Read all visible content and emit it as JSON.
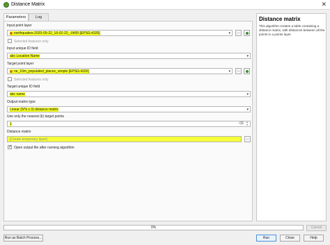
{
  "window": {
    "title": "Distance Matrix"
  },
  "tabs": [
    {
      "label": "Parameters"
    },
    {
      "label": "Log"
    }
  ],
  "form": {
    "input_point_layer": {
      "label": "Input point layer",
      "value": "earthquakes-2020-09-22_16-02-22_-0400 [EPSG:4326]",
      "selected_only_label": "Selected features only"
    },
    "input_unique_id": {
      "label": "Input unique ID field",
      "value": "abc Location Name"
    },
    "target_point_layer": {
      "label": "Target point layer",
      "value": "ne_10m_populated_places_simple [EPSG:4326]",
      "selected_only_label": "Selected features only"
    },
    "target_unique_id": {
      "label": "Target unique ID field",
      "value": "abc name"
    },
    "output_matrix_type": {
      "label": "Output matrix type",
      "value": "Linear (N*k x 3) distance matrix"
    },
    "nearest_k": {
      "label": "Use only the nearest (k) target points",
      "value": "1"
    },
    "distance_matrix": {
      "label": "Distance matrix",
      "value": "[Create temporary layer]"
    },
    "open_output": {
      "label": "Open output file after running algorithm",
      "checked": true
    }
  },
  "help": {
    "title": "Distance matrix",
    "text": "This algorithm creates a table containing a distance matrix, with distances between all the points in a points layer."
  },
  "progress": {
    "text": "0%",
    "value": 0
  },
  "buttons": {
    "cancel": "Cancel",
    "batch": "Run as Batch Process...",
    "run": "Run",
    "close": "Close",
    "help": "Help"
  },
  "colors": {
    "highlight": "#f4ff1e",
    "accent": "#4a90d9",
    "qgis_green": "#589632"
  }
}
